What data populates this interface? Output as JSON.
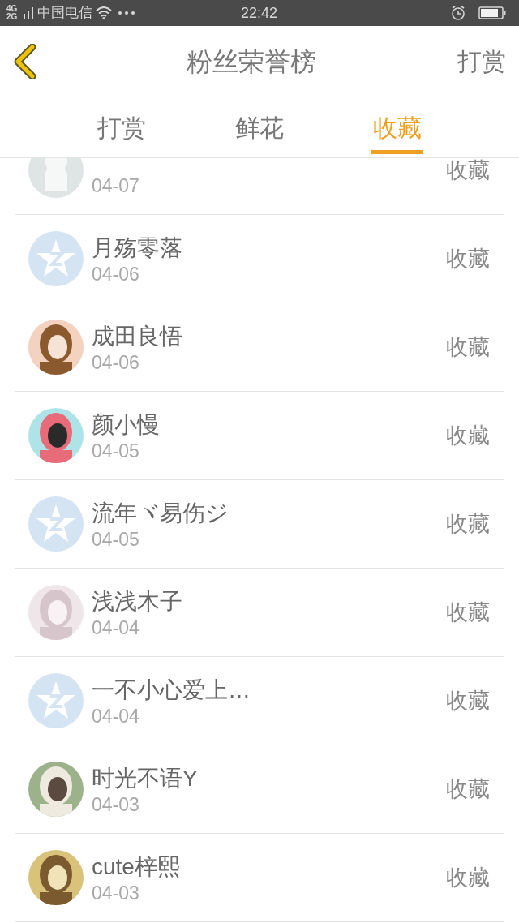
{
  "status_bar": {
    "network": "4G 2G",
    "carrier": "中国电信",
    "time": "22:42"
  },
  "header": {
    "title": "粉丝荣誉榜",
    "action": "打赏"
  },
  "tabs": [
    {
      "label": "打赏",
      "selected": false
    },
    {
      "label": "鲜花",
      "selected": false
    },
    {
      "label": "收藏",
      "selected": true
    }
  ],
  "rows": [
    {
      "kind": "blank",
      "date": "04-07",
      "action": "收藏"
    },
    {
      "kind": "default",
      "name": "月殇零落",
      "date": "04-06",
      "action": "收藏"
    },
    {
      "kind": "picture",
      "name": "成田良悟",
      "date": "04-06",
      "action": "收藏"
    },
    {
      "kind": "picture",
      "name": "颜小慢",
      "date": "04-05",
      "action": "收藏"
    },
    {
      "kind": "default",
      "name": "流年ヾ易伤ジ",
      "date": "04-05",
      "action": "收藏"
    },
    {
      "kind": "picture",
      "name": "浅浅木子",
      "date": "04-04",
      "action": "收藏"
    },
    {
      "kind": "default",
      "name": "一不小心爱上…",
      "date": "04-04",
      "action": "收藏"
    },
    {
      "kind": "picture",
      "name": "时光不语Y",
      "date": "04-03",
      "action": "收藏"
    },
    {
      "kind": "picture",
      "name": "cute梓熙",
      "date": "04-03",
      "action": "收藏"
    }
  ]
}
